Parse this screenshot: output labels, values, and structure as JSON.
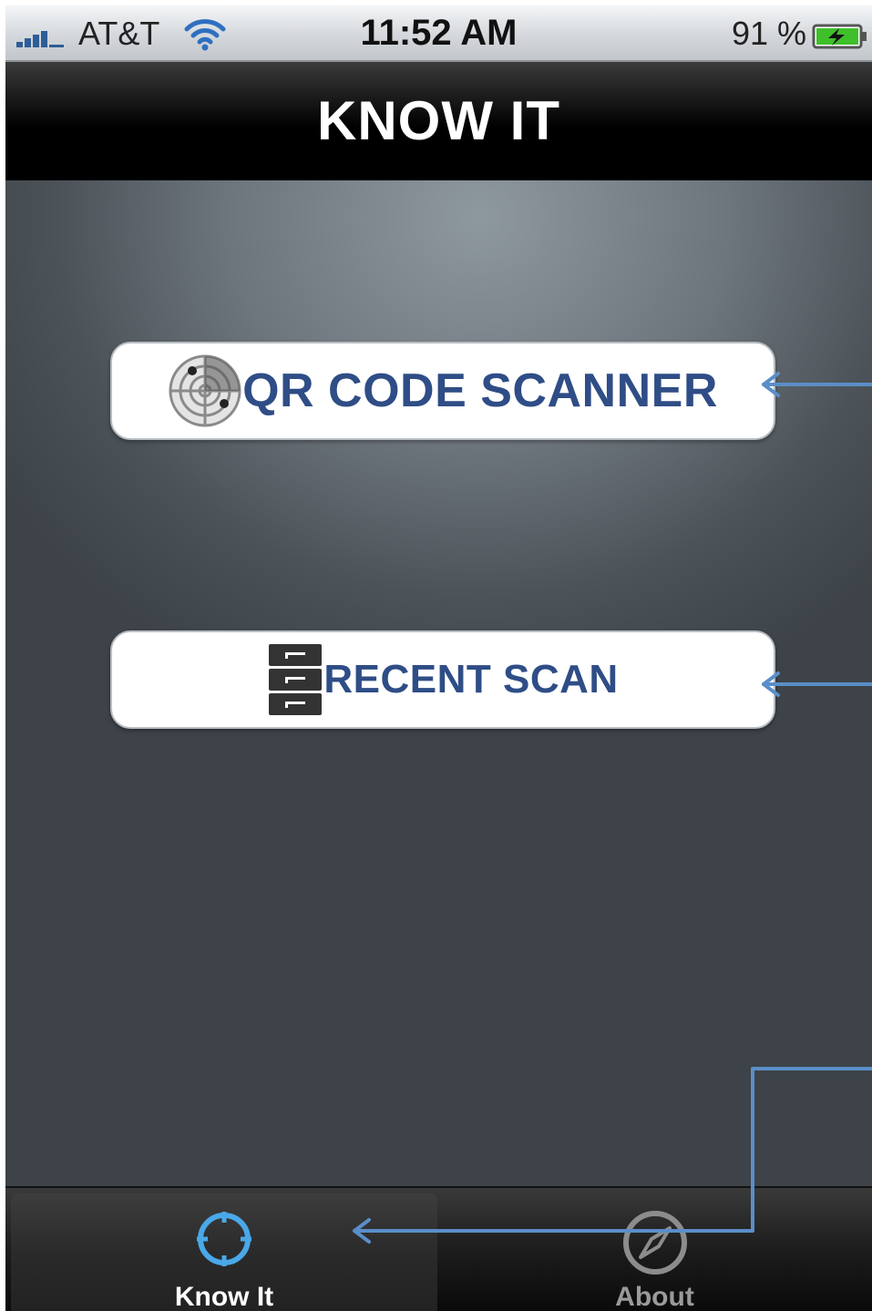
{
  "status_bar": {
    "carrier": "AT&T",
    "time": "11:52 AM",
    "battery": "91 %"
  },
  "nav_bar": {
    "title": "KNOW IT"
  },
  "main": {
    "qr_button_label": "QR CODE SCANNER",
    "recent_button_label": "RECENT SCAN"
  },
  "tabs": [
    {
      "label": "Know It",
      "icon": "crosshair-icon",
      "selected": true
    },
    {
      "label": "About",
      "icon": "compass-icon",
      "selected": false
    }
  ],
  "colors": {
    "button_text": "#2f4d86",
    "annotation_arrow": "#5a8ec8",
    "selected_tab_icon": "#4aa8e8"
  }
}
